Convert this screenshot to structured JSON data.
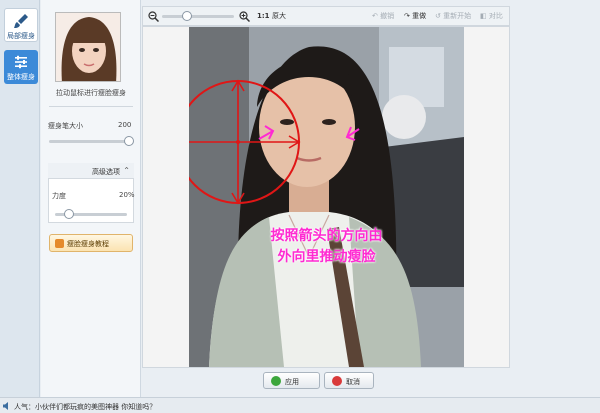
{
  "rail": {
    "tab_local": "局部瘦身",
    "tab_whole": "整体瘦身"
  },
  "panel": {
    "avatar_hint": "拉动鼠标进行瘦脸瘦身",
    "brush_label": "瘦身笔大小",
    "brush_value": "200",
    "brush_level": 0.95,
    "advanced_label": "高级选项",
    "strength_label": "力度",
    "strength_value": "20%",
    "strength_level": 0.2,
    "tutorial_label": "瘦脸瘦身教程"
  },
  "toolbar": {
    "zoom_label": "1:1",
    "original_label": "原大",
    "undo_label": "撤销",
    "redo_label": "重做",
    "restart_label": "重新开始",
    "compare_label": "对比",
    "zoom_level": 0.35
  },
  "canvas": {
    "annotation_line1": "按照箭头的方向由",
    "annotation_line2": "外向里推动瘦脸"
  },
  "footer": {
    "apply_label": "应用",
    "cancel_label": "取消"
  },
  "status": {
    "text": "人气：小伙伴们都玩疯的美图神器 你知道吗？"
  },
  "colors": {
    "accent": "#3c8ad8",
    "annotation": "#ff2ad2",
    "brush_circle": "#e01616"
  }
}
